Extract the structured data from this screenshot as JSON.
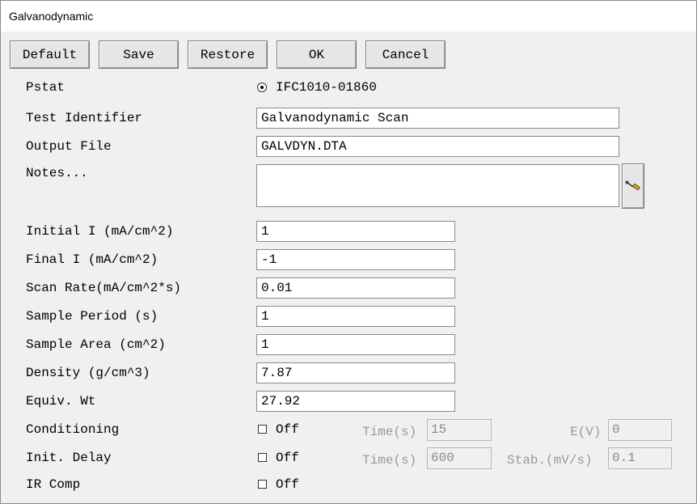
{
  "window": {
    "title": "Galvanodynamic"
  },
  "toolbar": {
    "default_label": "Default",
    "save_label": "Save",
    "restore_label": "Restore",
    "ok_label": "OK",
    "cancel_label": "Cancel"
  },
  "form": {
    "pstat": {
      "label": "Pstat",
      "option": "IFC1010-01860",
      "selected": true
    },
    "test_identifier": {
      "label": "Test Identifier",
      "value": "Galvanodynamic Scan"
    },
    "output_file": {
      "label": "Output File",
      "value": "GALVDYN.DTA"
    },
    "notes": {
      "label": "Notes...",
      "value": "",
      "icon": "screwdriver-icon"
    },
    "initial_i": {
      "label": "Initial I (mA/cm^2)",
      "value": "1"
    },
    "final_i": {
      "label": "Final I (mA/cm^2)",
      "value": "-1"
    },
    "scan_rate": {
      "label": "Scan Rate(mA/cm^2*s)",
      "value": "0.01"
    },
    "sample_period": {
      "label": "Sample Period (s)",
      "value": "1"
    },
    "sample_area": {
      "label": "Sample Area (cm^2)",
      "value": "1"
    },
    "density": {
      "label": "Density (g/cm^3)",
      "value": "7.87"
    },
    "equiv_wt": {
      "label": "Equiv. Wt",
      "value": "27.92"
    },
    "conditioning": {
      "label": "Conditioning",
      "checkbox_label": "Off",
      "checked": false,
      "time_label": "Time(s)",
      "time_value": "15",
      "e_label": "E(V)",
      "e_value": "0"
    },
    "init_delay": {
      "label": "Init. Delay",
      "checkbox_label": "Off",
      "checked": false,
      "time_label": "Time(s)",
      "time_value": "600",
      "stab_label": "Stab.(mV/s)",
      "stab_value": "0.1"
    },
    "ir_comp": {
      "label": "IR Comp",
      "checkbox_label": "Off",
      "checked": false
    }
  }
}
